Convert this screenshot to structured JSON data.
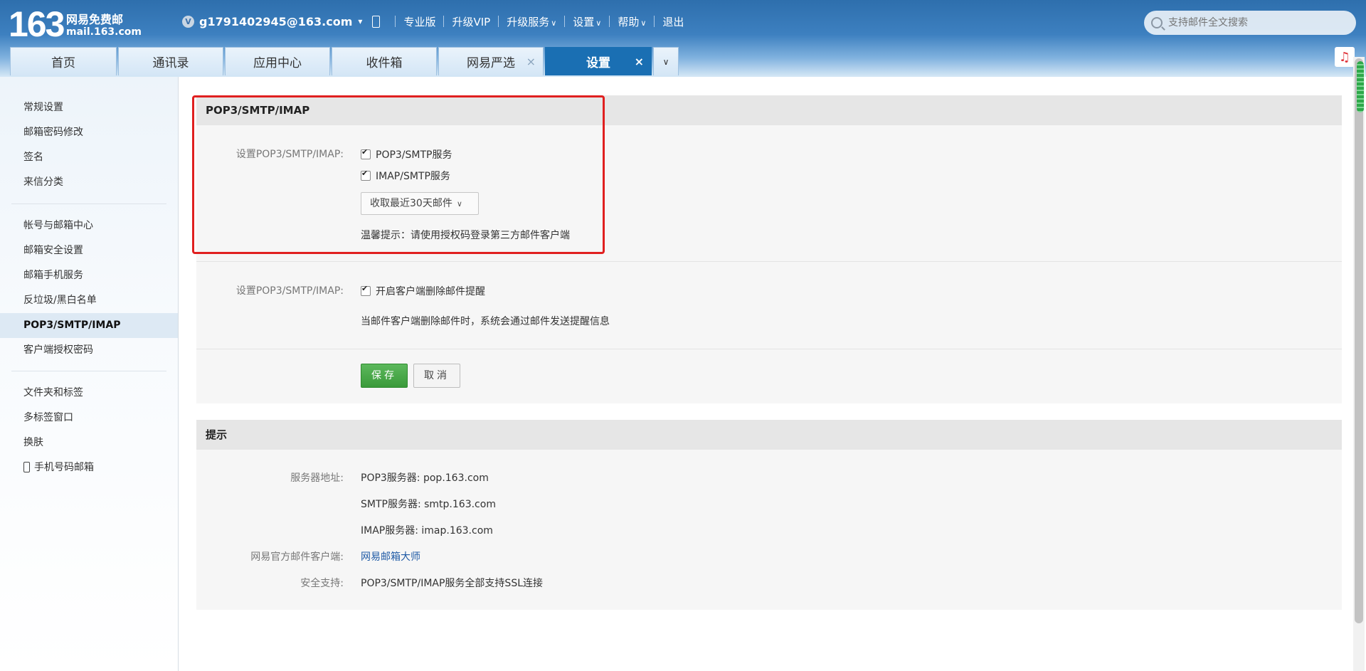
{
  "header": {
    "logo_number": "163",
    "logo_name": "网易免费邮",
    "logo_domain": "mail.163.com",
    "vip_badge": "V",
    "user_email": "g1791402945@163.com",
    "nav": [
      "专业版",
      "升级VIP",
      "升级服务",
      "设置",
      "帮助",
      "退出"
    ],
    "search_placeholder": "支持邮件全文搜索"
  },
  "tabs": [
    {
      "label": "首页"
    },
    {
      "label": "通讯录"
    },
    {
      "label": "应用中心"
    },
    {
      "label": "收件箱"
    },
    {
      "label": "网易严选"
    },
    {
      "label": "设置"
    }
  ],
  "sidebar": {
    "group1": [
      "常规设置",
      "邮箱密码修改",
      "签名",
      "来信分类"
    ],
    "group2": [
      "帐号与邮箱中心",
      "邮箱安全设置",
      "邮箱手机服务",
      "反垃圾/黑白名单",
      "POP3/SMTP/IMAP",
      "客户端授权密码"
    ],
    "group3": [
      "文件夹和标签",
      "多标签窗口",
      "换肤",
      "手机号码邮箱"
    ]
  },
  "settings": {
    "title": "POP3/SMTP/IMAP",
    "row1_label": "设置POP3/SMTP/IMAP:",
    "pop3_checkbox": "POP3/SMTP服务",
    "imap_checkbox": "IMAP/SMTP服务",
    "fetch_select": "收取最近30天邮件",
    "tip": "温馨提示：请使用授权码登录第三方邮件客户端",
    "row2_label": "设置POP3/SMTP/IMAP:",
    "delete_alert_checkbox": "开启客户端删除邮件提醒",
    "delete_alert_desc": "当邮件客户端删除邮件时，系统会通过邮件发送提醒信息",
    "save_button": "保存",
    "cancel_button": "取消"
  },
  "tips": {
    "title": "提示",
    "server_label": "服务器地址:",
    "pop3_server": "POP3服务器: pop.163.com",
    "smtp_server": "SMTP服务器: smtp.163.com",
    "imap_server": "IMAP服务器: imap.163.com",
    "client_label": "网易官方邮件客户端:",
    "client_link": "网易邮箱大师",
    "security_label": "安全支持:",
    "security_value": "POP3/SMTP/IMAP服务全部支持SSL连接"
  }
}
